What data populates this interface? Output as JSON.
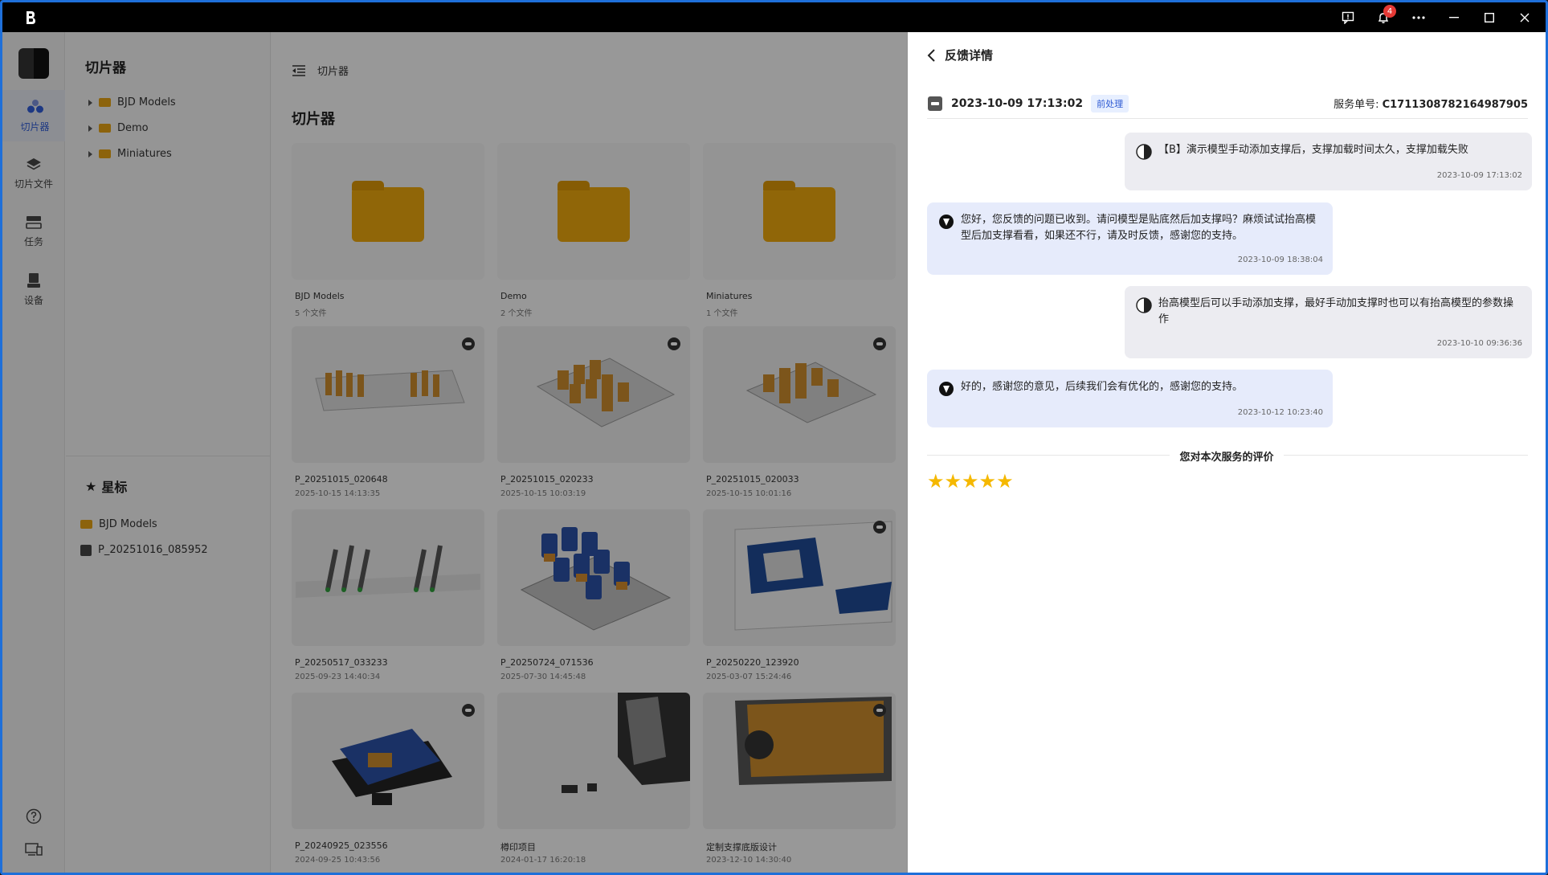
{
  "titlebar": {
    "notification_count": "4"
  },
  "leftnav": {
    "items": [
      {
        "label": "切片器"
      },
      {
        "label": "切片文件"
      },
      {
        "label": "任务"
      },
      {
        "label": "设备"
      }
    ]
  },
  "tree": {
    "title": "切片器",
    "folders": [
      "BJD Models",
      "Demo",
      "Miniatures"
    ],
    "starred_title": "星标",
    "starred": [
      "BJD Models",
      "P_20251016_085952"
    ]
  },
  "main": {
    "breadcrumb": "切片器",
    "title": "切片器",
    "cards": [
      {
        "name": "BJD Models",
        "sub": "5 个文件"
      },
      {
        "name": "Demo",
        "sub": "2 个文件"
      },
      {
        "name": "Miniatures",
        "sub": "1 个文件"
      },
      {
        "name": "P_20251015_020648",
        "sub": "2025-10-15 14:13:35"
      },
      {
        "name": "P_20251015_020233",
        "sub": "2025-10-15 10:03:19"
      },
      {
        "name": "P_20251015_020033",
        "sub": "2025-10-15 10:01:16"
      },
      {
        "name": "P_20250517_033233",
        "sub": "2025-09-23 14:40:34"
      },
      {
        "name": "P_20250724_071536",
        "sub": "2025-07-30 14:45:48"
      },
      {
        "name": "P_20250220_123920",
        "sub": "2025-03-07 15:24:46"
      },
      {
        "name": "P_20240925_023556",
        "sub": "2024-09-25 10:43:56"
      },
      {
        "name": "樽印项目",
        "sub": "2024-01-17 16:20:18"
      },
      {
        "name": "定制支撑底版设计",
        "sub": "2023-12-10 14:30:40"
      }
    ]
  },
  "panel": {
    "title": "反馈详情",
    "date": "2023-10-09 17:13:02",
    "tag": "前处理",
    "service_label": "服务单号:",
    "service_no": "C1711308782164987905",
    "messages": [
      {
        "text": "【B】演示模型手动添加支撑后，支撑加载时间太久，支撑加载失败",
        "time": "2023-10-09 17:13:02"
      },
      {
        "text": "您好，您反馈的问题已收到。请问模型是贴底然后加支撑吗？麻烦试试抬高模型后加支撑看看，如果还不行，请及时反馈，感谢您的支持。",
        "time": "2023-10-09 18:38:04"
      },
      {
        "text": "抬高模型后可以手动添加支撑，最好手动加支撑时也可以有抬高模型的参数操作",
        "time": "2023-10-10 09:36:36"
      },
      {
        "text": "好的，感谢您的意见，后续我们会有优化的，感谢您的支持。",
        "time": "2023-10-12 10:23:40"
      }
    ],
    "rating_label": "您对本次服务的评价",
    "stars": "★★★★★",
    "rating_value": 5
  }
}
